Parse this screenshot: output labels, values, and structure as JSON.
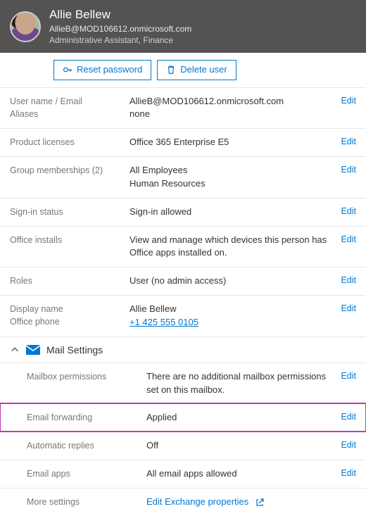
{
  "user": {
    "name": "Allie Bellew",
    "email": "AllieB@MOD106612.onmicrosoft.com",
    "role": "Administrative Assistant, Finance"
  },
  "buttons": {
    "reset_password": "Reset password",
    "delete_user": "Delete user"
  },
  "edit_label": "Edit",
  "details": {
    "username_label": "User name / Email",
    "username_value": "AllieB@MOD106612.onmicrosoft.com",
    "aliases_label": "Aliases",
    "aliases_value": "none",
    "licenses_label": "Product licenses",
    "licenses_value": "Office 365 Enterprise E5",
    "groups_label": "Group memberships (2)",
    "groups_value_1": "All Employees",
    "groups_value_2": "Human Resources",
    "signin_label": "Sign-in status",
    "signin_value": "Sign-in allowed",
    "installs_label": "Office installs",
    "installs_value": "View and manage which devices this person has Office apps installed on.",
    "roles_label": "Roles",
    "roles_value": "User (no admin access)",
    "display_name_label": "Display name",
    "display_name_value": "Allie Bellew",
    "office_phone_label": "Office phone",
    "office_phone_value": "+1 425 555 0105"
  },
  "mail_section": {
    "title": "Mail Settings",
    "perm_label": "Mailbox permissions",
    "perm_value": "There are no additional mailbox permissions set on this mailbox.",
    "fwd_label": "Email forwarding",
    "fwd_value": "Applied",
    "auto_label": "Automatic replies",
    "auto_value": "Off",
    "apps_label": "Email apps",
    "apps_value": "All email apps allowed",
    "more_label": "More settings",
    "more_value": "Edit Exchange properties"
  }
}
